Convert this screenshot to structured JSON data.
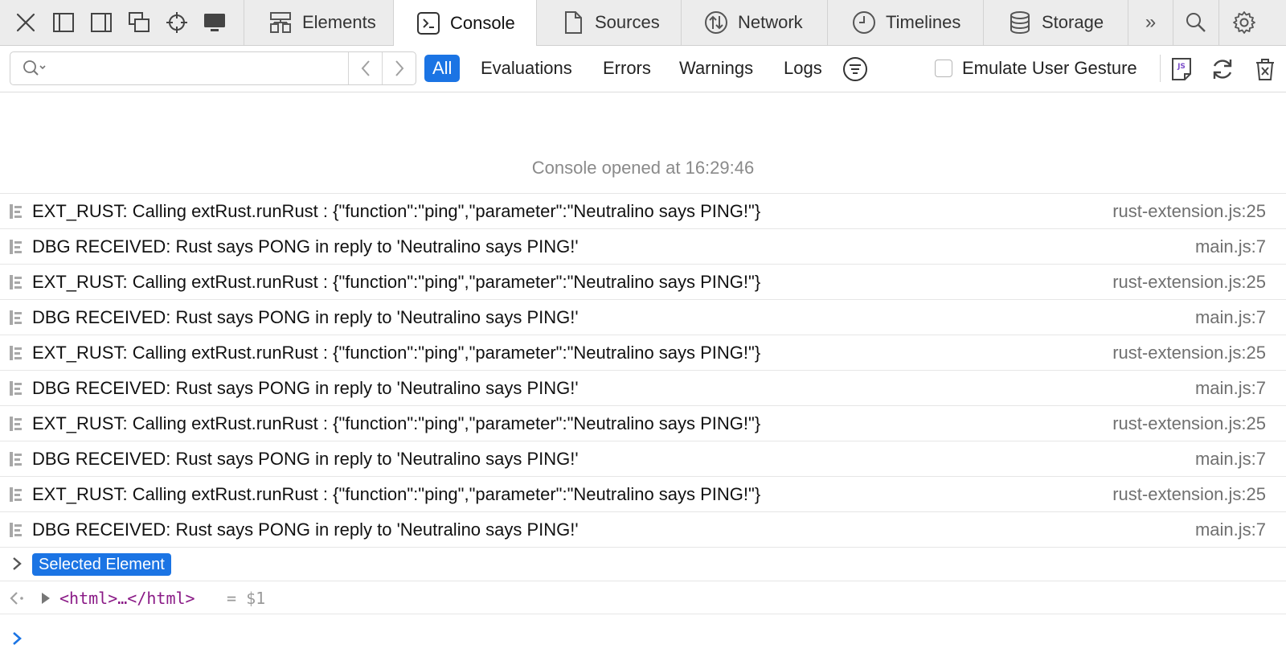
{
  "colors": {
    "accent": "#1b74e4",
    "markup": "#8a1a86",
    "muted": "#8a8a8a"
  },
  "toolbar_icons": [
    "close-icon",
    "dock-left-icon",
    "dock-right-icon",
    "undock-icon",
    "inspect-crosshair-icon",
    "device-icon"
  ],
  "tabs": [
    {
      "label": "Elements",
      "icon": "elements-icon",
      "active": false
    },
    {
      "label": "Console",
      "icon": "console-icon",
      "active": true
    },
    {
      "label": "Sources",
      "icon": "document-icon",
      "active": false
    },
    {
      "label": "Network",
      "icon": "network-icon",
      "active": false
    },
    {
      "label": "Timelines",
      "icon": "clock-icon",
      "active": false
    },
    {
      "label": "Storage",
      "icon": "database-icon",
      "active": false
    }
  ],
  "tab_more_label": "»",
  "filter": {
    "search_value": "",
    "buttons": [
      "All",
      "Evaluations",
      "Errors",
      "Warnings",
      "Logs"
    ],
    "active_button": "All",
    "emulate_label": "Emulate User Gesture",
    "emulate_checked": false
  },
  "console": {
    "opened_text": "Console opened at 16:29:46",
    "logs": [
      {
        "message": "EXT_RUST: Calling extRust.runRust : {\"function\":\"ping\",\"parameter\":\"Neutralino says PING!\"}",
        "source": "rust-extension.js:25"
      },
      {
        "message": "DBG RECEIVED: Rust says PONG in reply to 'Neutralino says PING!'",
        "source": "main.js:7"
      },
      {
        "message": "EXT_RUST: Calling extRust.runRust : {\"function\":\"ping\",\"parameter\":\"Neutralino says PING!\"}",
        "source": "rust-extension.js:25"
      },
      {
        "message": "DBG RECEIVED: Rust says PONG in reply to 'Neutralino says PING!'",
        "source": "main.js:7"
      },
      {
        "message": "EXT_RUST: Calling extRust.runRust : {\"function\":\"ping\",\"parameter\":\"Neutralino says PING!\"}",
        "source": "rust-extension.js:25"
      },
      {
        "message": "DBG RECEIVED: Rust says PONG in reply to 'Neutralino says PING!'",
        "source": "main.js:7"
      },
      {
        "message": "EXT_RUST: Calling extRust.runRust : {\"function\":\"ping\",\"parameter\":\"Neutralino says PING!\"}",
        "source": "rust-extension.js:25"
      },
      {
        "message": "DBG RECEIVED: Rust says PONG in reply to 'Neutralino says PING!'",
        "source": "main.js:7"
      },
      {
        "message": "EXT_RUST: Calling extRust.runRust : {\"function\":\"ping\",\"parameter\":\"Neutralino says PING!\"}",
        "source": "rust-extension.js:25"
      },
      {
        "message": "DBG RECEIVED: Rust says PONG in reply to 'Neutralino says PING!'",
        "source": "main.js:7"
      }
    ],
    "selected_element_label": "Selected Element",
    "result_markup": "<html>…</html>",
    "result_var": "= $1",
    "prompt_value": ""
  }
}
